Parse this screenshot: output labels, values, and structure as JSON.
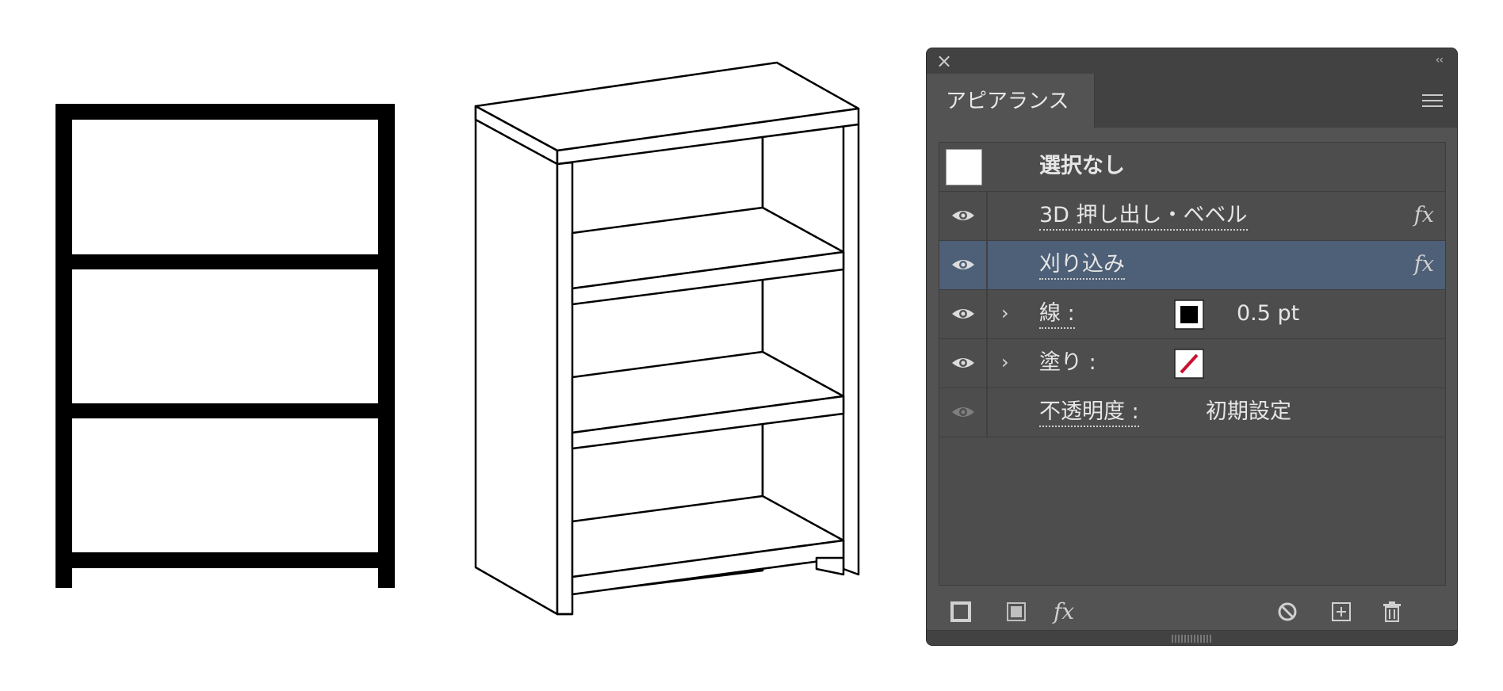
{
  "panel": {
    "tab_label": "アピアランス",
    "close_icon": "close-icon",
    "collapse_icon": "collapse-icon",
    "collapse_glyph": "‹‹",
    "menu_icon": "panel-menu-icon"
  },
  "rows": [
    {
      "label": "選択なし",
      "type": "header"
    },
    {
      "label": "3D 押し出し・ベベル",
      "fx": "fx",
      "visible": true
    },
    {
      "label": "刈り込み",
      "fx": "fx",
      "visible": true,
      "selected": true
    },
    {
      "label": "線 :",
      "value": "0.5 pt",
      "swatch": "black-stroke",
      "visible": true
    },
    {
      "label": "塗り :",
      "swatch": "none-fill",
      "visible": true
    },
    {
      "label": "不透明度 :",
      "value": "初期設定",
      "visible": false
    }
  ],
  "bottom_toolbar": {
    "add_stroke": "add-stroke-icon",
    "add_fill": "add-fill-icon",
    "fx_label": "fx",
    "clear": "clear-appearance-icon",
    "duplicate": "duplicate-item-icon",
    "delete": "delete-item-icon"
  },
  "colors": {
    "panel_bg": "#535353",
    "selected_row": "#4e6077",
    "none_slash": "#c8102e"
  }
}
